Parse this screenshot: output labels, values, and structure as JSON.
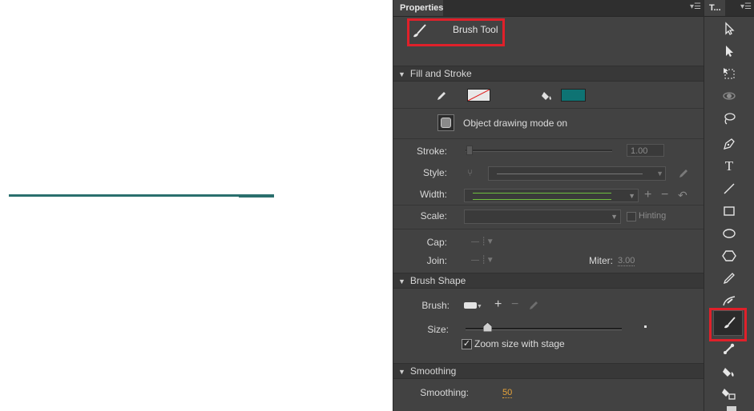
{
  "properties_panel": {
    "tab_label": "Properties",
    "tool_name": "Brush Tool",
    "sections": {
      "fill_and_stroke": "Fill and Stroke",
      "brush_shape": "Brush Shape",
      "smoothing": "Smoothing"
    },
    "object_drawing_mode": "Object drawing mode on",
    "stroke_label": "Stroke:",
    "stroke_value": "1.00",
    "style_label": "Style:",
    "width_label": "Width:",
    "scale_label": "Scale:",
    "hinting_label": "Hinting",
    "cap_label": "Cap:",
    "join_label": "Join:",
    "miter_label": "Miter:",
    "miter_value": "3.00",
    "brush_label": "Brush:",
    "size_label": "Size:",
    "zoom_size_label": "Zoom size with stage",
    "zoom_size_checked": true,
    "smoothing_label": "Smoothing:",
    "smoothing_value": "50",
    "fill_color": "#0e7373",
    "stroke_color": "none"
  },
  "tools_panel": {
    "tab_label": "T...",
    "tools": [
      "selection-tool",
      "subselection-tool",
      "free-transform-tool",
      "3d-rotation-tool",
      "lasso-tool",
      "pen-tool",
      "text-tool",
      "line-tool",
      "rectangle-tool",
      "oval-tool",
      "polystar-tool",
      "pencil-tool",
      "paint-brush-tool",
      "brush-tool",
      "bone-tool",
      "paint-bucket-tool",
      "ink-bottle-tool"
    ],
    "selected_tool": "brush-tool"
  },
  "stage": {
    "line_color": "#2a6f6d"
  }
}
